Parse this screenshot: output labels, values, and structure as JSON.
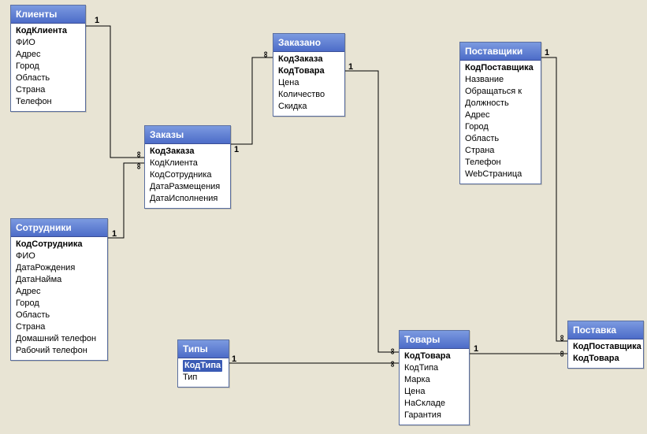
{
  "entities": {
    "clients": {
      "title": "Клиенты",
      "fields": [
        "КодКлиента",
        "ФИО",
        "Адрес",
        "Город",
        "Область",
        "Страна",
        "Телефон"
      ],
      "pk": [
        "КодКлиента"
      ]
    },
    "orders": {
      "title": "Заказы",
      "fields": [
        "КодЗаказа",
        "КодКлиента",
        "КодСотрудника",
        "ДатаРазмещения",
        "ДатаИсполнения"
      ],
      "pk": [
        "КодЗаказа"
      ]
    },
    "orderDetails": {
      "title": "Заказано",
      "fields": [
        "КодЗаказа",
        "КодТовара",
        "Цена",
        "Количество",
        "Скидка"
      ],
      "pk": [
        "КодЗаказа",
        "КодТовара"
      ]
    },
    "employees": {
      "title": "Сотрудники",
      "fields": [
        "КодСотрудника",
        "ФИО",
        "ДатаРождения",
        "ДатаНайма",
        "Адрес",
        "Город",
        "Область",
        "Страна",
        "Домашний телефон",
        "Рабочий телефон"
      ],
      "pk": [
        "КодСотрудника"
      ]
    },
    "types": {
      "title": "Типы",
      "fields": [
        "КодТипа",
        "Тип"
      ],
      "pk": [
        "КодТипа"
      ]
    },
    "products": {
      "title": "Товары",
      "fields": [
        "КодТовара",
        "КодТипа",
        "Марка",
        "Цена",
        "НаСкладе",
        "Гарантия"
      ],
      "pk": [
        "КодТовара"
      ]
    },
    "suppliers": {
      "title": "Поставщики",
      "fields": [
        "КодПоставщика",
        "Название",
        "Обращаться к",
        "Должность",
        "Адрес",
        "Город",
        "Область",
        "Страна",
        "Телефон",
        "WebСтраница"
      ],
      "pk": [
        "КодПоставщика"
      ]
    },
    "supply": {
      "title": "Поставка",
      "fields": [
        "КодПоставщика",
        "КодТовара"
      ],
      "pk": [
        "КодПоставщика",
        "КодТовара"
      ]
    }
  },
  "cardinality": {
    "one": "1",
    "many": "∞"
  }
}
